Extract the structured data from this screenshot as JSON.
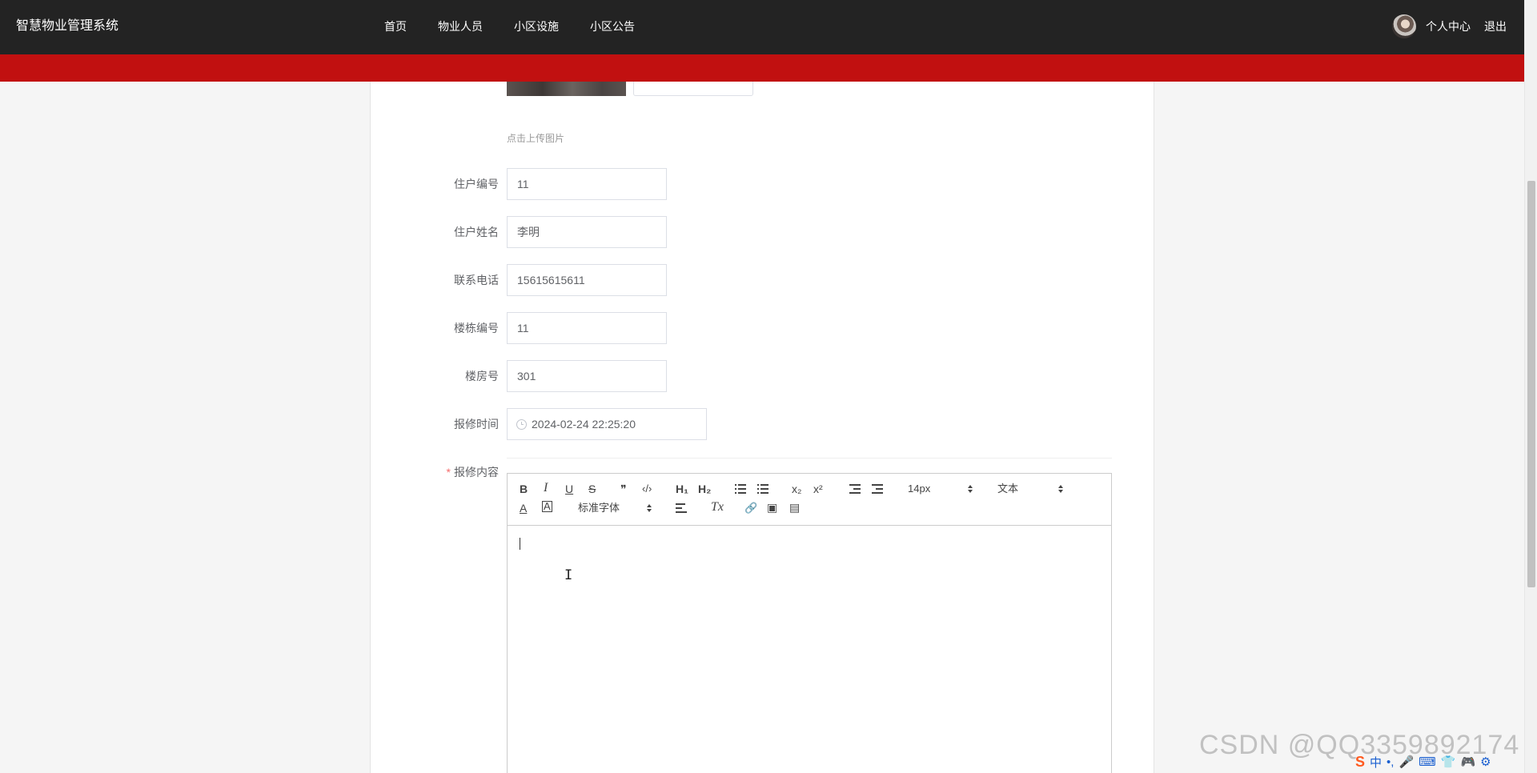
{
  "app": {
    "title": "智慧物业管理系统"
  },
  "nav": {
    "items": [
      "首页",
      "物业人员",
      "小区设施",
      "小区公告"
    ]
  },
  "user": {
    "profile_label": "个人中心",
    "logout_label": "退出"
  },
  "upload": {
    "tip": "点击上传图片"
  },
  "form": {
    "fields": [
      {
        "label": "住户编号",
        "value": "11"
      },
      {
        "label": "住户姓名",
        "value": "李明"
      },
      {
        "label": "联系电话",
        "value": "15615615611"
      },
      {
        "label": "楼栋编号",
        "value": "11"
      },
      {
        "label": "楼房号",
        "value": "301"
      }
    ],
    "date_field": {
      "label": "报修时间",
      "value": "2024-02-24 22:25:20"
    },
    "content_field": {
      "required_mark": "*",
      "label": "报修内容"
    }
  },
  "editor": {
    "toolbar": {
      "bold": "B",
      "italic": "I",
      "underline": "U",
      "strike": "S",
      "quote": "❞",
      "code": "‹/›",
      "h1": "H₁",
      "h2": "H₂",
      "sub": "x₂",
      "sup": "x²",
      "size": "14px",
      "header": "文本",
      "font_color": "A",
      "bg_color": "A",
      "font": "标准字体",
      "clean": "Tx",
      "link": "🔗",
      "image": "▣",
      "video": "▤"
    }
  },
  "watermark": "CSDN @QQ3359892174",
  "ime": {
    "logo": "S",
    "items": [
      "中",
      "•,",
      "🎤",
      "⌨",
      "👕",
      "🎮",
      "⚙"
    ]
  }
}
